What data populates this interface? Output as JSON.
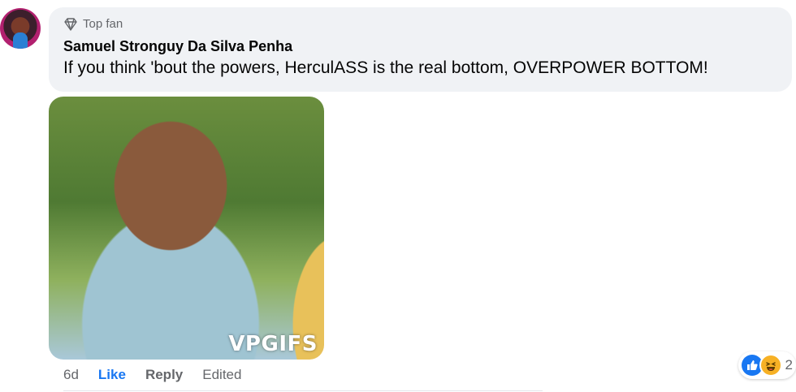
{
  "comment": {
    "badge_label": "Top fan",
    "author": "Samuel Stronguy Da Silva Penha",
    "text": "If you think 'bout the powers, HerculASS is the real bottom, OVERPOWER BOTTOM!",
    "gif_label": "VPGIFS"
  },
  "actions": {
    "time": "6d",
    "like_label": "Like",
    "reply_label": "Reply",
    "edited_label": "Edited"
  },
  "reactions": {
    "count": "2",
    "types": [
      "like-icon",
      "haha-icon"
    ]
  },
  "colors": {
    "bubble": "#f0f2f5",
    "link_blue": "#1877f2",
    "meta_gray": "#65676b"
  }
}
